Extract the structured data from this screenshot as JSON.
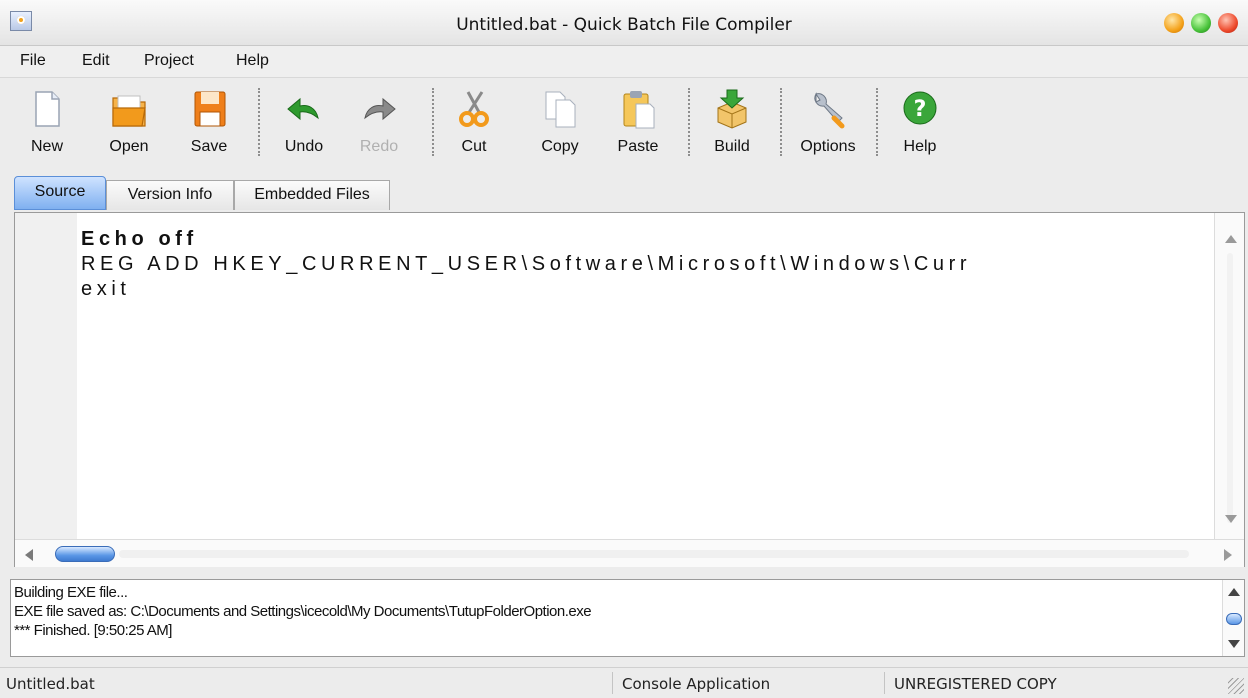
{
  "window": {
    "title": "Untitled.bat - Quick Batch File Compiler",
    "icon": "app-icon"
  },
  "menu": [
    "File",
    "Edit",
    "Project",
    "Help"
  ],
  "toolbar": {
    "buttons": [
      {
        "label": "New",
        "icon": "new-document-icon"
      },
      {
        "label": "Open",
        "icon": "open-folder-icon"
      },
      {
        "label": "Save",
        "icon": "save-floppy-icon"
      },
      {
        "label": "Undo",
        "icon": "undo-arrow-icon"
      },
      {
        "label": "Redo",
        "icon": "redo-arrow-icon",
        "disabled": true
      },
      {
        "label": "Cut",
        "icon": "scissors-icon"
      },
      {
        "label": "Copy",
        "icon": "copy-icon"
      },
      {
        "label": "Paste",
        "icon": "paste-clipboard-icon"
      },
      {
        "label": "Build",
        "icon": "build-box-icon"
      },
      {
        "label": "Options",
        "icon": "wrench-icon"
      },
      {
        "label": "Help",
        "icon": "help-question-icon"
      }
    ]
  },
  "tabs": [
    {
      "label": "Source",
      "active": true
    },
    {
      "label": "Version Info",
      "active": false
    },
    {
      "label": "Embedded Files",
      "active": false
    }
  ],
  "editor": {
    "lines": [
      "Echo off",
      "REG ADD HKEY_CURRENT_USER\\Software\\Microsoft\\Windows\\Curr",
      "exit"
    ]
  },
  "output": {
    "lines": [
      "Building EXE file...",
      "EXE file saved as: C:\\Documents and Settings\\icecold\\My Documents\\TutupFolderOption.exe",
      "*** Finished. [9:50:25 AM]"
    ]
  },
  "status": {
    "file": "Untitled.bat",
    "app_type": "Console Application",
    "registration": "UNREGISTERED COPY"
  },
  "colors": {
    "accent": "#5b97e6",
    "undo_green": "#2e9a2e",
    "help_green": "#3aa63a",
    "folder_orange": "#f29a1c"
  }
}
